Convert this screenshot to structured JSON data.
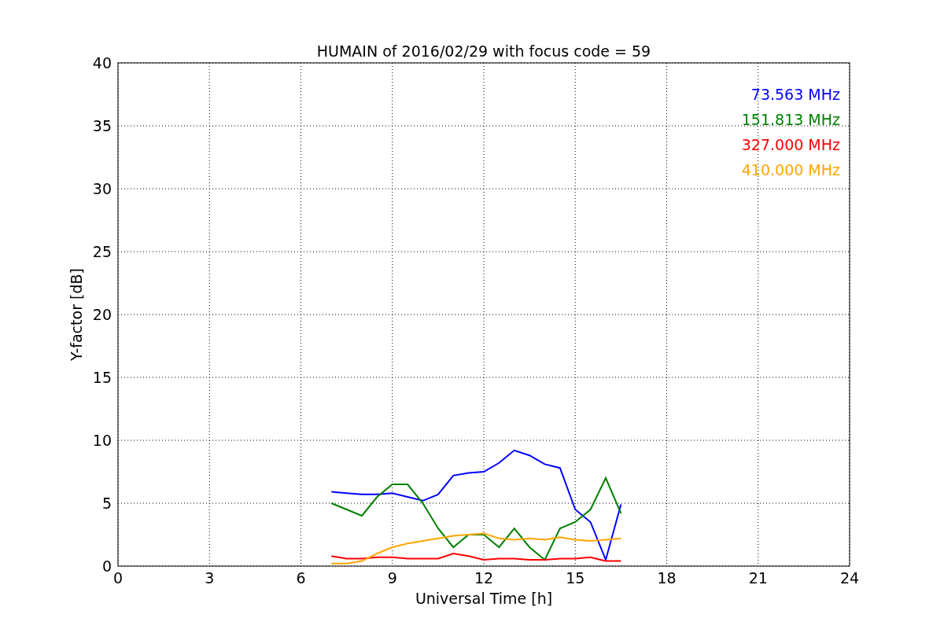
{
  "figure": {
    "chart_data": {
      "type": "line",
      "grid": true,
      "title": "HUMAIN of 2016/02/29 with focus code = 59",
      "xlabel": "Universal Time [h]",
      "ylabel": "Y-factor [dB]",
      "xlim": [
        0,
        24
      ],
      "ylim": [
        0,
        40
      ],
      "xticks": [
        0,
        3,
        6,
        9,
        12,
        15,
        18,
        21,
        24
      ],
      "yticks": [
        0,
        5,
        10,
        15,
        20,
        25,
        30,
        35,
        40
      ],
      "x": [
        7,
        7.5,
        8,
        8.5,
        9,
        9.5,
        10,
        10.5,
        11,
        11.5,
        12,
        12.5,
        13,
        13.5,
        14,
        14.5,
        15,
        15.5,
        16,
        16.5
      ],
      "series": [
        {
          "name": "73.563 MHz",
          "color": "#0000ff",
          "values": [
            5.9,
            5.8,
            5.7,
            5.7,
            5.8,
            5.5,
            5.2,
            5.7,
            7.2,
            7.4,
            7.5,
            8.2,
            9.2,
            8.8,
            8.1,
            7.8,
            4.5,
            3.5,
            0.5,
            4.9
          ]
        },
        {
          "name": "151.813 MHz",
          "color": "#008000",
          "values": [
            5,
            4.5,
            4,
            5.5,
            6.5,
            6.5,
            5,
            3,
            1.5,
            2.5,
            2.5,
            1.5,
            3,
            1.5,
            0.5,
            3,
            3.5,
            4.5,
            7,
            4.2
          ]
        },
        {
          "name": "327.000 MHz",
          "color": "#ff0000",
          "values": [
            0.8,
            0.6,
            0.6,
            0.7,
            0.7,
            0.6,
            0.6,
            0.6,
            1,
            0.8,
            0.5,
            0.6,
            0.6,
            0.5,
            0.5,
            0.6,
            0.6,
            0.7,
            0.4,
            0.4
          ]
        },
        {
          "name": "410.000 MHz",
          "color": "#ffa500",
          "values": [
            0.2,
            0.2,
            0.4,
            1,
            1.5,
            1.8,
            2,
            2.2,
            2.4,
            2.5,
            2.6,
            2.2,
            2.1,
            2.2,
            2.1,
            2.3,
            2.1,
            2,
            2.1,
            2.2
          ]
        }
      ]
    }
  }
}
